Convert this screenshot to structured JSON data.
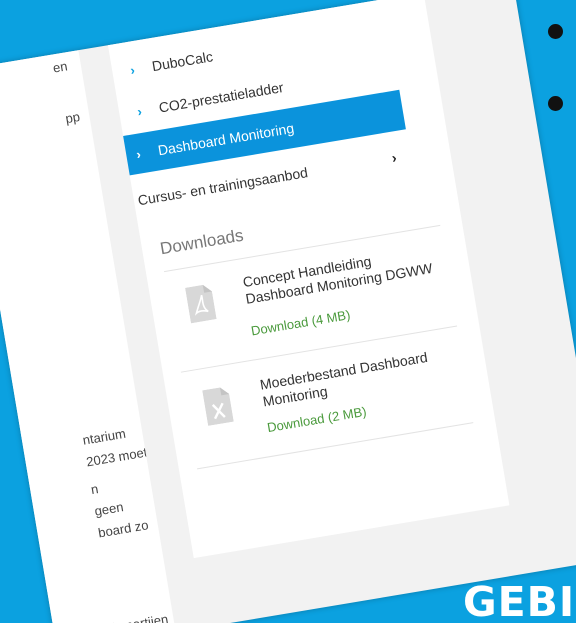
{
  "left_column": {
    "lines": [
      "en",
      "pp",
      "ntarium",
      "2023 moet",
      "n",
      "geen",
      "board zo",
      "en alle partijen"
    ]
  },
  "nav": {
    "items": [
      {
        "label": "DuboCalc"
      },
      {
        "label": "CO2-prestatieladder"
      },
      {
        "label": "Dashboard Monitoring"
      },
      {
        "label": "Cursus- en trainingsaanbod"
      }
    ]
  },
  "downloads": {
    "title": "Downloads",
    "items": [
      {
        "title": "Concept Handleiding Dashboard Monitoring DGWW",
        "link": "Download (4 MB)",
        "icon": "pdf-file-icon"
      },
      {
        "title": "Moederbestand Dashboard Monitoring",
        "link": "Download (2 MB)",
        "icon": "excel-file-icon"
      }
    ]
  },
  "slide": {
    "bottom_text": "GEBI"
  },
  "colors": {
    "background": "#0ba1e0",
    "active_nav": "#0b93dc",
    "link_green": "#4a9a3c"
  }
}
